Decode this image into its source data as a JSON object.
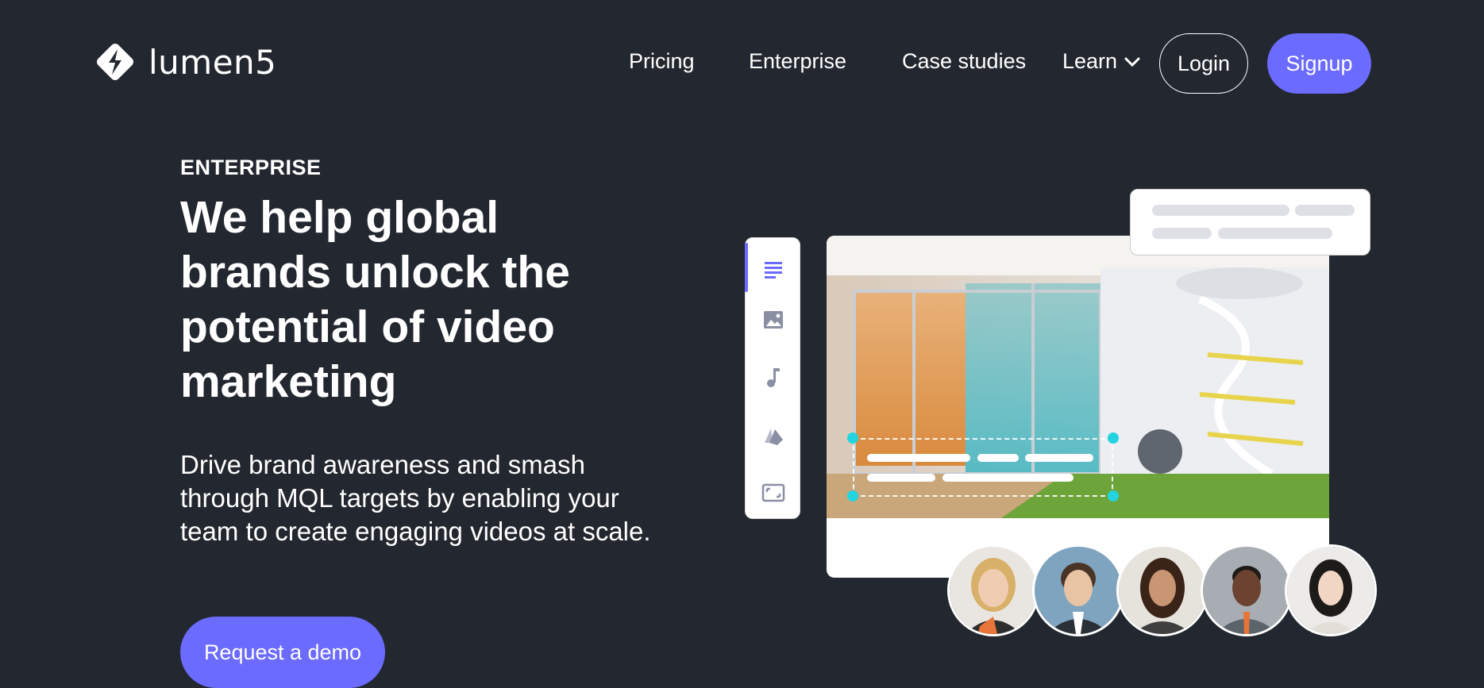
{
  "nav": {
    "logo_text": "lumen5",
    "links": [
      "Pricing",
      "Enterprise",
      "Case studies"
    ],
    "learn_label": "Learn",
    "login_label": "Login",
    "signup_label": "Signup"
  },
  "hero": {
    "eyebrow": "ENTERPRISE",
    "headline": "We help global brands unlock the potential of video marketing",
    "subtext": "Drive brand awareness and smash through MQL targets by enabling your team to create engaging videos at scale.",
    "cta_label": "Request a demo"
  },
  "editor": {
    "toolbar_icons": [
      "text-icon",
      "image-icon",
      "music-icon",
      "style-icon",
      "resize-icon"
    ],
    "avatars": [
      "avatar-woman-blonde",
      "avatar-man-suit",
      "avatar-woman-dark-hair",
      "avatar-man-beard",
      "avatar-woman-asian"
    ]
  },
  "colors": {
    "background": "#23272f",
    "accent": "#6b6bff",
    "handle": "#22d3e0"
  }
}
